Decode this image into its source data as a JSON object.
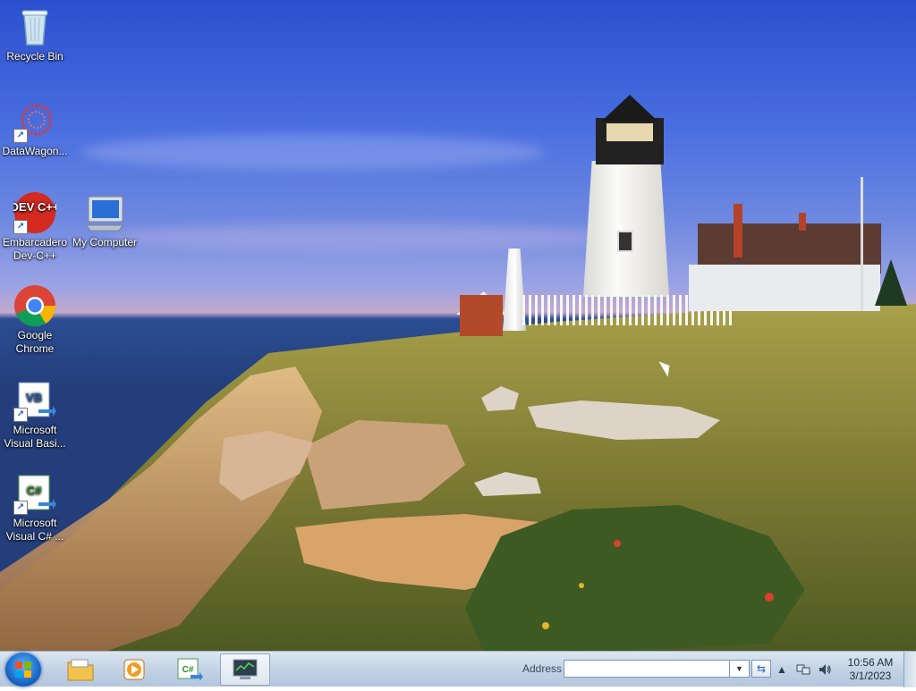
{
  "desktop": {
    "icons": [
      {
        "label": "Recycle Bin",
        "icon": "recycle-bin-icon",
        "shortcut": false
      },
      {
        "label": "DataWagon...",
        "icon": "datawagon-icon",
        "shortcut": true
      },
      {
        "label": "Embarcadero Dev-C++",
        "icon": "devcpp-icon",
        "shortcut": true,
        "badge": "DEV C++"
      },
      {
        "label": "My Computer",
        "icon": "my-computer-icon",
        "shortcut": false
      },
      {
        "label": "Google Chrome",
        "icon": "chrome-icon",
        "shortcut": false
      },
      {
        "label": "Microsoft Visual Basi...",
        "icon": "visual-basic-icon",
        "shortcut": true,
        "badge": "VB"
      },
      {
        "label": "Microsoft Visual C# ...",
        "icon": "visual-csharp-icon",
        "shortcut": true,
        "badge": "C#"
      }
    ]
  },
  "taskbar": {
    "start_icon": "windows-start-icon",
    "pinned": [
      {
        "name": "file-explorer",
        "icon": "folder-icon"
      },
      {
        "name": "media-player",
        "icon": "media-player-icon"
      },
      {
        "name": "visual-csharp",
        "icon": "visual-csharp-icon",
        "badge": "C#"
      },
      {
        "name": "task-manager",
        "icon": "monitor-icon",
        "active": true
      }
    ],
    "address": {
      "label": "Address",
      "value": ""
    },
    "tray": {
      "icons": [
        "show-hidden-icon",
        "network-icon",
        "volume-icon"
      ],
      "time": "10:56 AM",
      "date": "3/1/2023"
    }
  },
  "colors": {
    "taskbar_top": "#dbe6f2",
    "taskbar_bottom": "#b3c6dd",
    "sky_top": "#2c4fd0",
    "sea": "#233e7a",
    "grass": "#8a8a3a"
  }
}
